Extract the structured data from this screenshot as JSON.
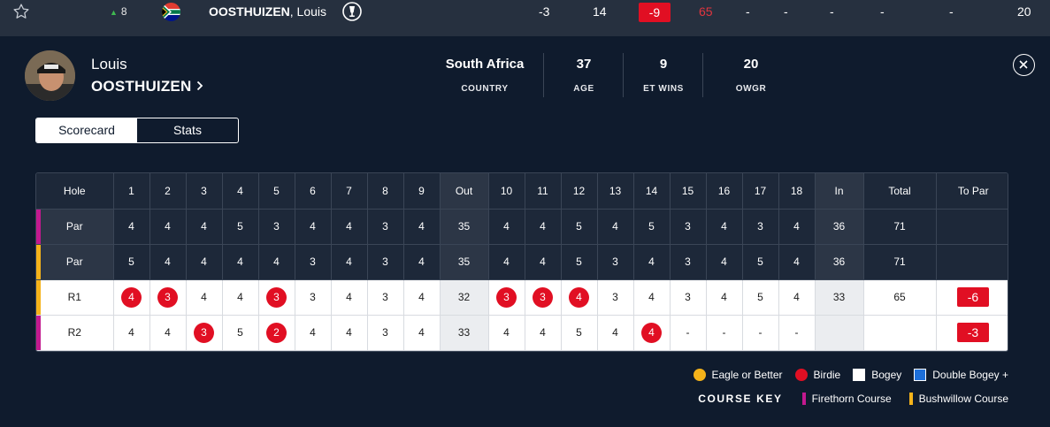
{
  "top_row": {
    "movement": "8",
    "name_last": "OOSTHUIZEN",
    "name_first": ", Louis",
    "cells": [
      "-3",
      "14",
      "-9",
      "65",
      "-",
      "-",
      "-",
      "-",
      "-",
      "20"
    ]
  },
  "player": {
    "first_name": "Louis",
    "last_name": "OOSTHUIZEN"
  },
  "stats": [
    {
      "value": "South Africa",
      "label": "COUNTRY"
    },
    {
      "value": "37",
      "label": "AGE"
    },
    {
      "value": "9",
      "label": "ET WINS"
    },
    {
      "value": "20",
      "label": "OWGR"
    }
  ],
  "tabs": [
    "Scorecard",
    "Stats"
  ],
  "scorecard": {
    "header": [
      "Hole",
      "1",
      "2",
      "3",
      "4",
      "5",
      "6",
      "7",
      "8",
      "9",
      "Out",
      "10",
      "11",
      "12",
      "13",
      "14",
      "15",
      "16",
      "17",
      "18",
      "In",
      "Total",
      "To Par"
    ],
    "rows": [
      {
        "label": "Par",
        "course": "firethorn",
        "cells": [
          "4",
          "4",
          "4",
          "5",
          "3",
          "4",
          "4",
          "3",
          "4",
          "35",
          "4",
          "4",
          "5",
          "4",
          "5",
          "3",
          "4",
          "3",
          "4",
          "36",
          "71",
          ""
        ]
      },
      {
        "label": "Par",
        "course": "bushwillow",
        "cells": [
          "5",
          "4",
          "4",
          "4",
          "4",
          "3",
          "4",
          "3",
          "4",
          "35",
          "4",
          "4",
          "5",
          "3",
          "4",
          "3",
          "4",
          "5",
          "4",
          "36",
          "71",
          ""
        ]
      },
      {
        "label": "R1",
        "course": "bushwillow",
        "cells": [
          "4",
          "3",
          "4",
          "4",
          "3",
          "3",
          "4",
          "3",
          "4",
          "32",
          "3",
          "3",
          "4",
          "3",
          "4",
          "3",
          "4",
          "5",
          "4",
          "33",
          "65",
          "-6"
        ],
        "birdies": [
          0,
          1,
          4,
          10,
          11,
          12
        ]
      },
      {
        "label": "R2",
        "course": "firethorn",
        "cells": [
          "4",
          "4",
          "3",
          "5",
          "2",
          "4",
          "4",
          "3",
          "4",
          "33",
          "4",
          "4",
          "5",
          "4",
          "4",
          "-",
          "-",
          "-",
          "-",
          "",
          "",
          "-3"
        ],
        "birdies": [
          2,
          4,
          14
        ]
      }
    ]
  },
  "key": {
    "eagle": "Eagle or Better",
    "birdie": "Birdie",
    "bogey": "Bogey",
    "double": "Double Bogey +",
    "title": "COURSE KEY",
    "firethorn": "Firethorn Course",
    "bushwillow": "Bushwillow Course"
  },
  "colors": {
    "background": "#0f1b2d",
    "birdie": "#e10f23",
    "eagle": "#f5b31a",
    "double_bogey": "#1d6fd9",
    "firethorn": "#c2198f",
    "bushwillow": "#f5b31a"
  },
  "icons": {
    "favorite": "star-icon",
    "flag": "south-africa-flag-icon",
    "champion": "claret-jug-icon",
    "profile_link": "chevron-right-icon",
    "close": "close-icon"
  }
}
